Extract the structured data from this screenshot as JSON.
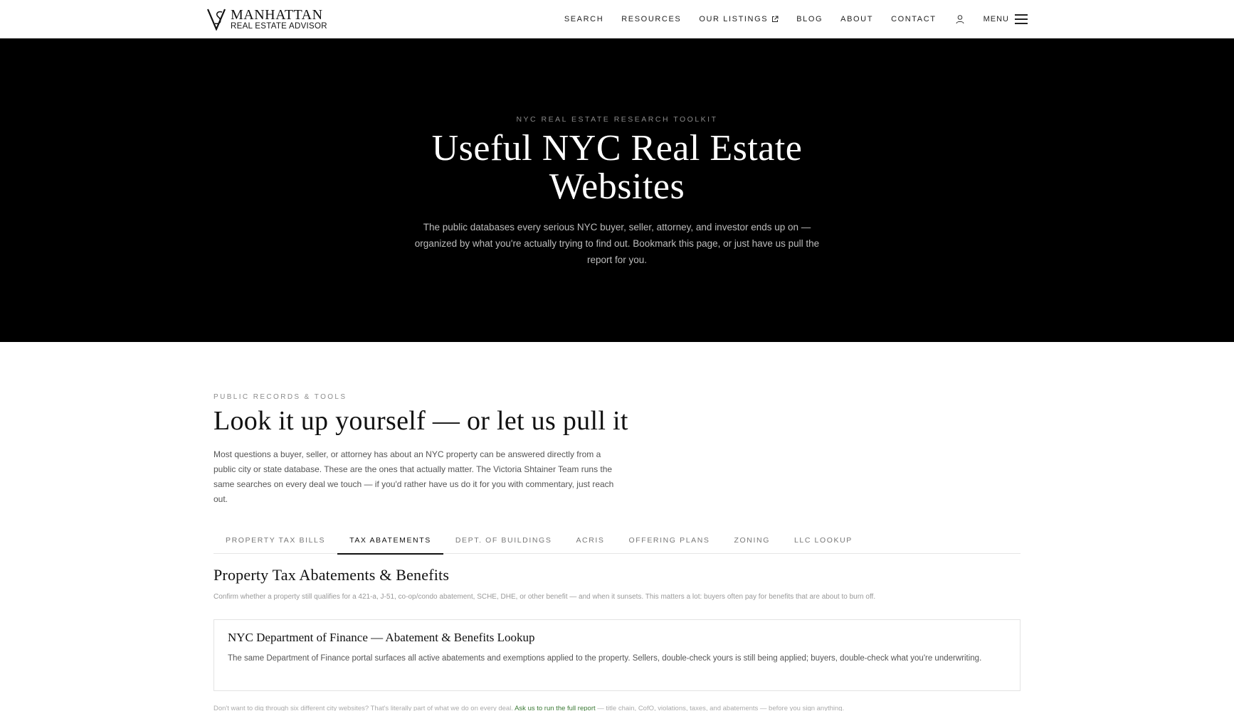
{
  "header": {
    "logo_line1": "MANHATTAN",
    "logo_line2": "REAL ESTATE ADVISOR",
    "nav": {
      "search": "SEARCH",
      "resources": "RESOURCES",
      "listings": "OUR LISTINGS",
      "blog": "BLOG",
      "about": "ABOUT",
      "contact": "CONTACT"
    },
    "menu_label": "MENU"
  },
  "hero": {
    "eyebrow": "NYC REAL ESTATE RESEARCH TOOLKIT",
    "title": "Useful NYC Real Estate Websites",
    "description": "The public databases every serious NYC buyer, seller, attorney, and investor ends up on — organized by what you're actually trying to find out. Bookmark this page, or just have us pull the report for you."
  },
  "section": {
    "eyebrow": "PUBLIC RECORDS & TOOLS",
    "title": "Look it up yourself — or let us pull it",
    "description": "Most questions a buyer, seller, or attorney has about an NYC property can be answered directly from a public city or state database. These are the ones that actually matter. The Victoria Shtainer Team runs the same searches on every deal we touch — if you'd rather have us do it for you with commentary, just reach out."
  },
  "tabs": [
    {
      "label": "PROPERTY TAX BILLS"
    },
    {
      "label": "TAX ABATEMENTS"
    },
    {
      "label": "DEPT. OF BUILDINGS"
    },
    {
      "label": "ACRIS"
    },
    {
      "label": "OFFERING PLANS"
    },
    {
      "label": "ZONING"
    },
    {
      "label": "LLC LOOKUP"
    }
  ],
  "active_tab": "TAX ABATEMENTS",
  "panel": {
    "title": "Property Tax Abatements & Benefits",
    "description": "Confirm whether a property still qualifies for a 421-a, J-51, co-op/condo abatement, SCHE, DHE, or other benefit — and when it sunsets. This matters a lot: buyers often pay for benefits that are about to burn off.",
    "card": {
      "title": "NYC Department of Finance — Abatement & Benefits Lookup",
      "description": "The same Department of Finance portal surfaces all active abatements and exemptions applied to the property. Sellers, double-check yours is still being applied; buyers, double-check what you're underwriting."
    }
  },
  "footnote": {
    "before": "Don't want to dig through six different city websites? That's literally part of what we do on every deal. ",
    "link": "Ask us to run the full report",
    "after": " — title chain, CofO, violations, taxes, and abatements — before you sign anything."
  },
  "colors": {
    "hero_bg": "#000000",
    "accent_link": "#3b7a35",
    "text_dark": "#111111"
  }
}
